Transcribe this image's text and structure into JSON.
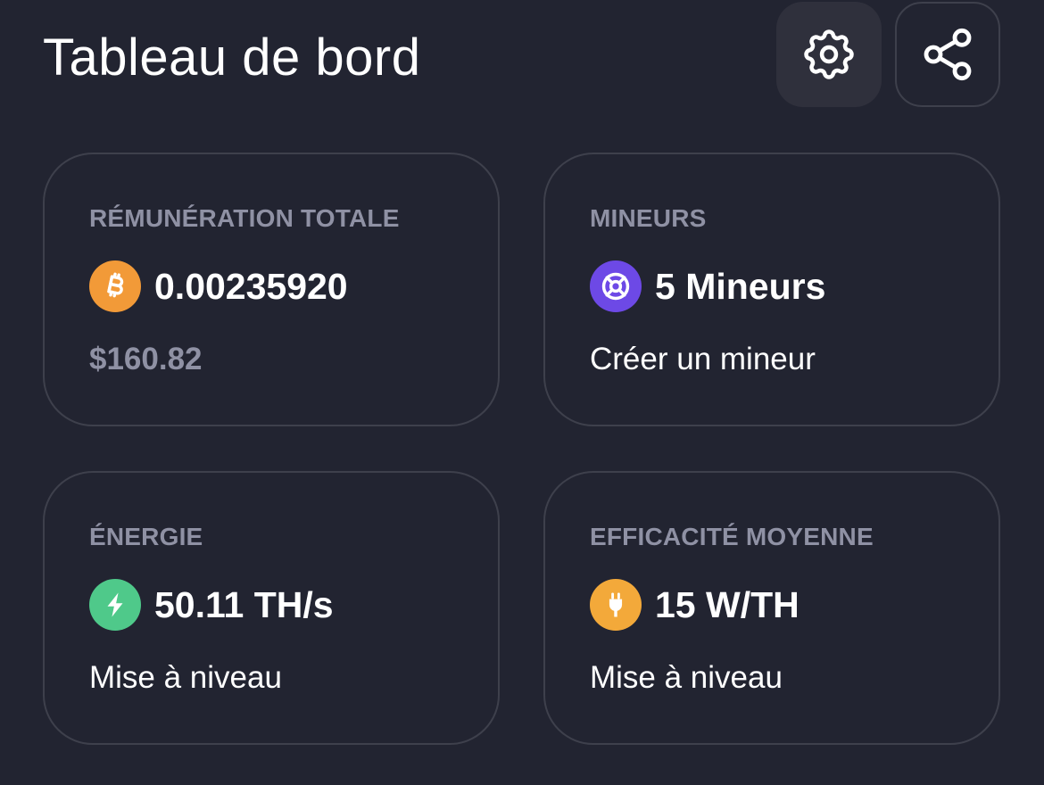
{
  "header": {
    "title": "Tableau de bord",
    "settings_icon": "gear-icon",
    "share_icon": "share-icon"
  },
  "colors": {
    "background": "#222431",
    "card_border": "#3e404c",
    "label": "#8f91a4",
    "bitcoin": "#f29a38",
    "miners": "#6d49e6",
    "energy": "#4fc98a",
    "efficiency": "#f3a93a"
  },
  "cards": [
    {
      "label": "RÉMUNÉRATION TOTALE",
      "icon": "bitcoin-icon",
      "value": "0.00235920",
      "sub": "$160.82"
    },
    {
      "label": "MINEURS",
      "icon": "miner-icon",
      "value": "5 Mineurs",
      "sub": "Créer un mineur"
    },
    {
      "label": "ÉNERGIE",
      "icon": "lightning-icon",
      "value": "50.11 TH/s",
      "sub": "Mise à niveau"
    },
    {
      "label": "EFFICACITÉ MOYENNE",
      "icon": "plug-icon",
      "value": "15 W/TH",
      "sub": "Mise à niveau"
    }
  ]
}
